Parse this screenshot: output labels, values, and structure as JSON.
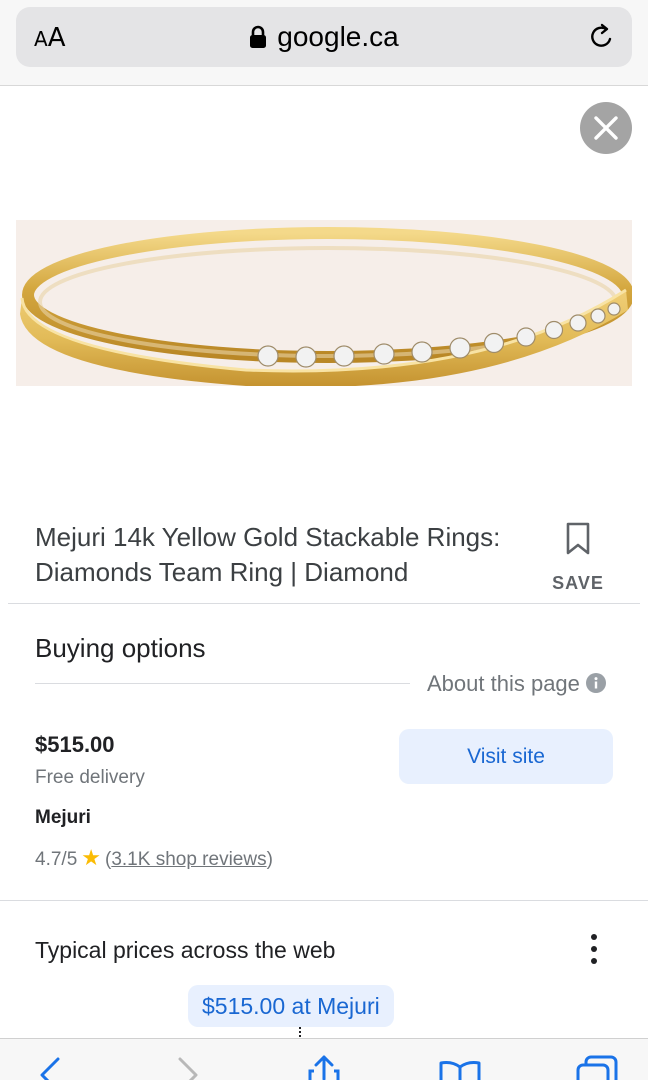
{
  "browser": {
    "text_size_label_small": "A",
    "text_size_label_large": "A",
    "domain": "google.ca"
  },
  "product": {
    "title": "Mejuri 14k Yellow Gold Stackable Rings: Diamonds Team Ring | Diamond",
    "save_label": "SAVE"
  },
  "buying_options": {
    "title": "Buying options",
    "about_label": "About this page",
    "offer": {
      "price": "$515.00",
      "delivery": "Free delivery",
      "merchant": "Mejuri",
      "rating": "4.7/5",
      "reviews_open": "(",
      "reviews_link": "3.1K shop reviews",
      "reviews_close": ")",
      "visit_label": "Visit site"
    }
  },
  "typical_prices": {
    "title": "Typical prices across the web",
    "chip_label": "$515.00 at Mejuri"
  },
  "toolbar": {
    "icons": [
      "back-icon",
      "forward-icon",
      "share-icon",
      "bookmarks-icon",
      "tabs-icon"
    ]
  },
  "colors": {
    "link_blue": "#1967d2",
    "chip_bg": "#e8f0fe",
    "star": "#fbbc04"
  }
}
